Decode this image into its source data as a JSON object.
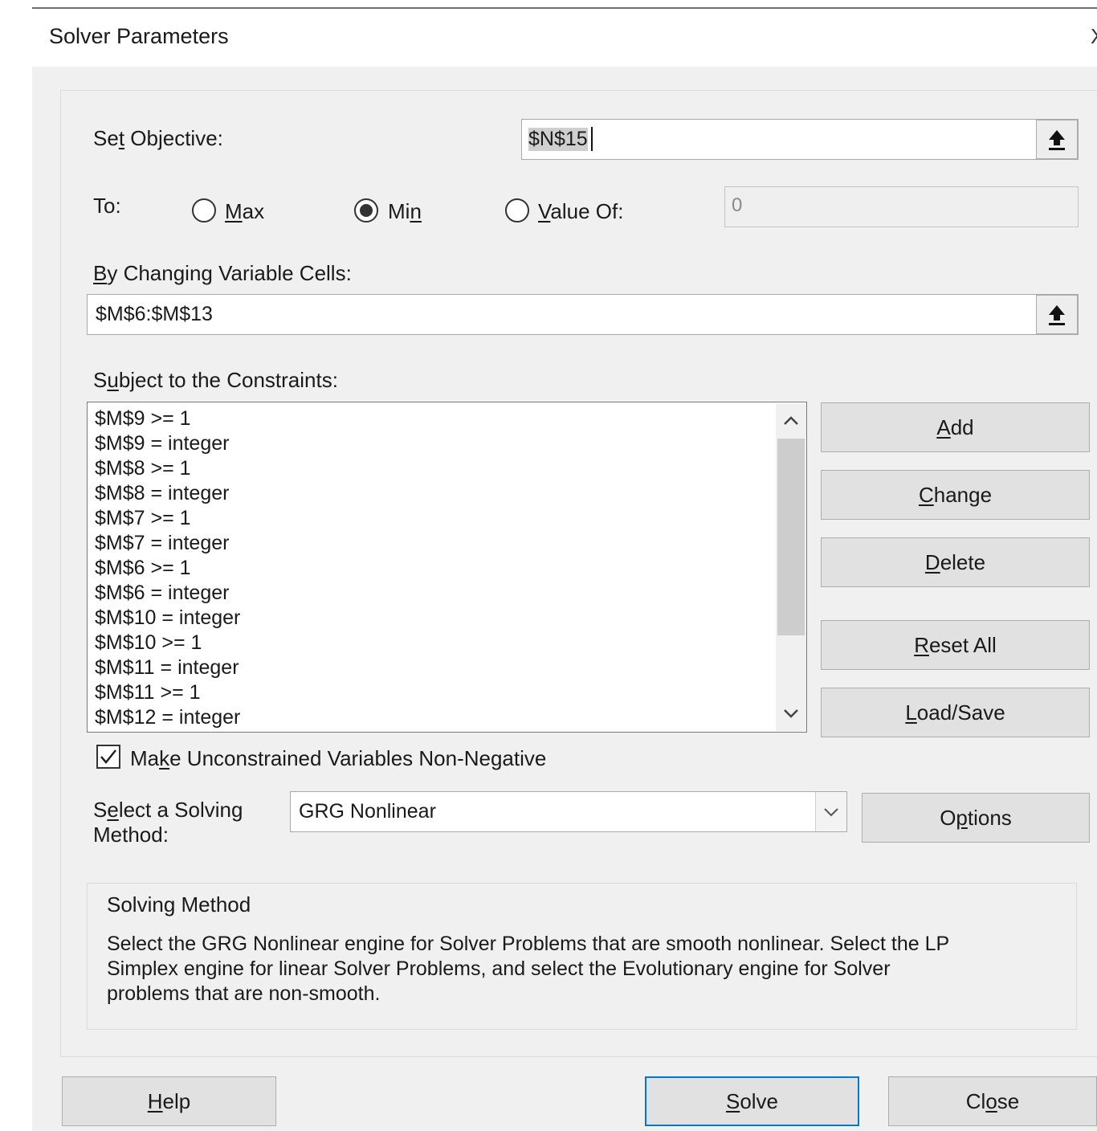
{
  "dialog": {
    "title": "Solver Parameters",
    "close_glyph": "X"
  },
  "objective": {
    "label_pre": "Se",
    "label_u": "t",
    "label_post": " Objective:",
    "value": "$N$15"
  },
  "to": {
    "label": "To:",
    "options": [
      {
        "pre": "",
        "u": "M",
        "post": "ax",
        "selected": false
      },
      {
        "pre": "Mi",
        "u": "n",
        "post": "",
        "selected": true
      },
      {
        "pre": "",
        "u": "V",
        "post": "alue Of:",
        "selected": false
      }
    ],
    "value_of": "0"
  },
  "variable_cells": {
    "label_u": "B",
    "label_post": "y Changing Variable Cells:",
    "value": "$M$6:$M$13"
  },
  "constraints": {
    "label_pre": "S",
    "label_u": "u",
    "label_post": "bject to the Constraints:",
    "items": [
      "$M$9 >= 1",
      "$M$9 = integer",
      "$M$8 >= 1",
      "$M$8 = integer",
      "$M$7 >= 1",
      "$M$7 = integer",
      "$M$6 >= 1",
      "$M$6 = integer",
      "$M$10 = integer",
      "$M$10 >= 1",
      "$M$11 = integer",
      "$M$11 >= 1",
      "$M$12 = integer"
    ]
  },
  "side_buttons": {
    "add": {
      "pre": "",
      "u": "A",
      "post": "dd"
    },
    "change": {
      "pre": "",
      "u": "C",
      "post": "hange"
    },
    "delete": {
      "pre": "",
      "u": "D",
      "post": "elete"
    },
    "reset": {
      "pre": "",
      "u": "R",
      "post": "eset All"
    },
    "loadsave": {
      "pre": "",
      "u": "L",
      "post": "oad/Save"
    }
  },
  "nonneg": {
    "checked": true,
    "pre": "Ma",
    "u": "k",
    "post": "e Unconstrained Variables Non-Negative"
  },
  "method": {
    "label_line1_pre": "S",
    "label_line1_u": "e",
    "label_line1_post": "lect a Solving",
    "label_line2": "Method:",
    "selected": "GRG Nonlinear",
    "options_btn": {
      "pre": "O",
      "u": "p",
      "post": "tions"
    }
  },
  "solving_method": {
    "heading": "Solving Method",
    "lines": [
      "Select the GRG Nonlinear engine for Solver Problems that are smooth nonlinear. Select the LP",
      "Simplex engine for linear Solver Problems, and select the Evolutionary engine for Solver",
      "problems that are non-smooth."
    ]
  },
  "footer": {
    "help": {
      "pre": "",
      "u": "H",
      "post": "elp"
    },
    "solve": {
      "pre": "",
      "u": "S",
      "post": "olve"
    },
    "close": {
      "pre": "Cl",
      "u": "o",
      "post": "se"
    }
  }
}
